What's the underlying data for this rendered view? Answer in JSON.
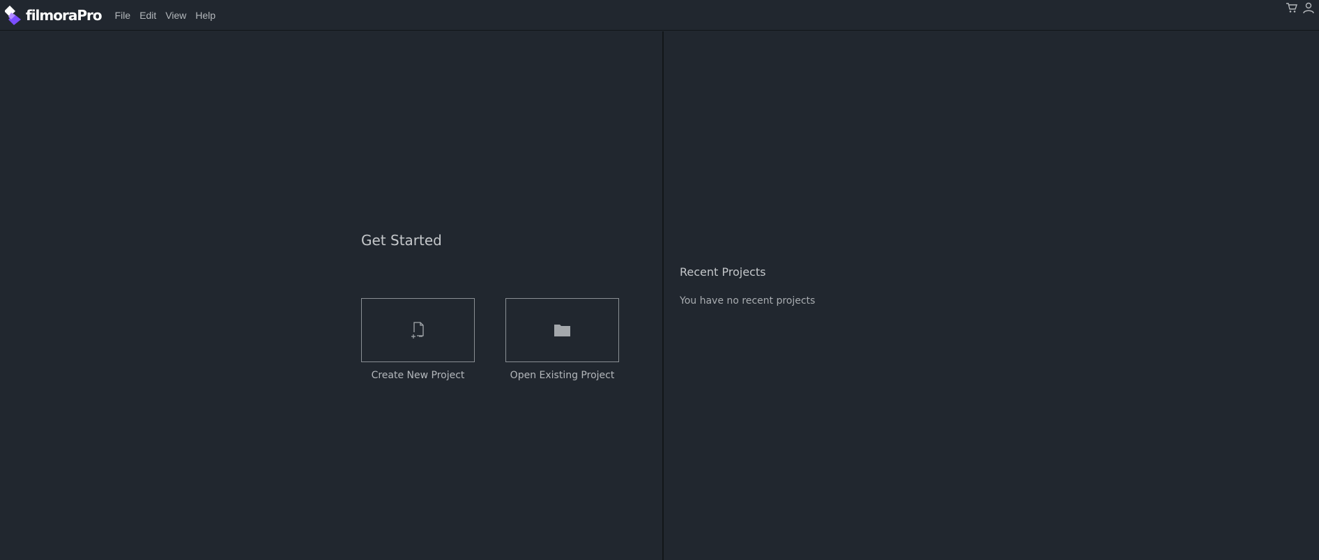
{
  "app": {
    "logo_text": "filmoraPro",
    "brand_colors": {
      "purple": "#7b4dff",
      "violet": "#b28cff"
    }
  },
  "menu": {
    "items": [
      {
        "label": "File"
      },
      {
        "label": "Edit"
      },
      {
        "label": "View"
      },
      {
        "label": "Help"
      }
    ]
  },
  "top_icons": [
    {
      "name": "cart-icon"
    },
    {
      "name": "user-icon"
    }
  ],
  "get_started": {
    "title": "Get Started",
    "tiles": [
      {
        "label": "Create New Project",
        "icon": "new-file-icon"
      },
      {
        "label": "Open Existing Project",
        "icon": "folder-icon"
      }
    ]
  },
  "recent_projects": {
    "title": "Recent Projects",
    "empty_message": "You have no recent projects"
  }
}
